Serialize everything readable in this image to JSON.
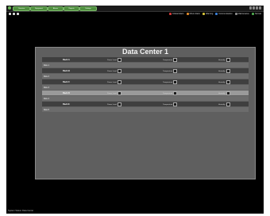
{
  "nav": {
    "tabs": [
      "Overview",
      "Equipment",
      "Alarms",
      "Reports",
      "Settings"
    ]
  },
  "legend": [
    {
      "label": "Critical Alarm",
      "color": "#d63a3a"
    },
    {
      "label": "Minor Alarm",
      "color": "#e08a2a"
    },
    {
      "label": "Warning",
      "color": "#d6c43a"
    },
    {
      "label": "Communication",
      "color": "#3a7fd6"
    },
    {
      "label": "Maintenance",
      "color": "#8a8a8a"
    },
    {
      "label": "Normal",
      "color": "#4fa84f"
    }
  ],
  "panel": {
    "title": "Data Center 1",
    "rows": [
      {
        "name": "",
        "label": "Rack A",
        "style": "dark",
        "cells": [
          "Power Load",
          "Temperature",
          "Humidity"
        ]
      },
      {
        "name": "Row 1",
        "label": "",
        "style": "light",
        "cells": [
          "",
          "",
          ""
        ]
      },
      {
        "name": "",
        "label": "Rack B",
        "style": "dark",
        "cells": [
          "Power Load",
          "Temperature",
          "Humidity"
        ]
      },
      {
        "name": "Row 2",
        "label": "",
        "style": "light",
        "cells": [
          "",
          "",
          ""
        ]
      },
      {
        "name": "",
        "label": "Rack C",
        "style": "dark",
        "cells": [
          "Power Load",
          "Temperature",
          "Humidity"
        ]
      },
      {
        "name": "Row 3",
        "label": "",
        "style": "light",
        "cells": [
          "",
          "",
          ""
        ]
      },
      {
        "name": "",
        "label": "Rack D",
        "style": "hl",
        "cells": [
          "Power Load",
          "Temperature",
          "Humidity"
        ]
      },
      {
        "name": "Row 4",
        "label": "",
        "style": "light",
        "cells": [
          "",
          "",
          ""
        ]
      },
      {
        "name": "",
        "label": "Rack E",
        "style": "dark",
        "cells": [
          "Power Load",
          "Temperature",
          "Humidity"
        ]
      },
      {
        "name": "Row 5",
        "label": "",
        "style": "light",
        "cells": [
          "",
          "",
          ""
        ]
      }
    ]
  },
  "footer": {
    "text": "System Status: Data Center"
  }
}
